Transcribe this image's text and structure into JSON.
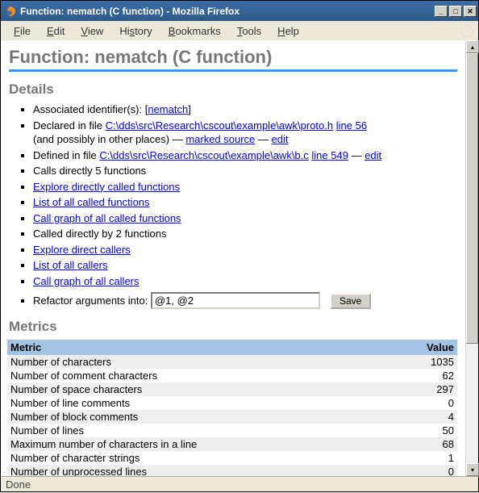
{
  "window": {
    "title": "Function: nematch (C function) - Mozilla Firefox"
  },
  "menu": {
    "file": "File",
    "edit": "Edit",
    "view": "View",
    "history": "History",
    "bookmarks": "Bookmarks",
    "tools": "Tools",
    "help": "Help"
  },
  "page": {
    "heading": "Function: nematch (C function)",
    "details_heading": "Details",
    "metrics_heading": "Metrics"
  },
  "details": {
    "assoc_label": "Associated identifier(s): [",
    "assoc_link": "nematch",
    "assoc_close": "]",
    "declared_label": "Declared in file ",
    "declared_file": "C:\\dds\\src\\Research\\cscout\\example\\awk\\proto.h",
    "declared_line_label": "line 56",
    "declared_extra": "(and possibly in other places) — ",
    "marked_source": "marked source",
    "dash": " — ",
    "edit": "edit",
    "defined_label": "Defined in file ",
    "defined_file": "C:\\dds\\src\\Research\\cscout\\example\\awk\\b.c",
    "defined_line_label": "line 549",
    "calls_directly": "Calls directly 5 functions",
    "explore_called": "Explore directly called functions",
    "list_called": "List of all called functions",
    "graph_called": "Call graph of all called functions",
    "called_by": "Called directly by 2 functions",
    "explore_callers": "Explore direct callers",
    "list_callers": "List of all callers",
    "graph_callers": "Call graph of all callers",
    "refactor_label": "Refactor arguments into: ",
    "refactor_value": "@1, @2",
    "save_label": "Save"
  },
  "metrics": {
    "header_metric": "Metric",
    "header_value": "Value",
    "rows": [
      {
        "name": "Number of characters",
        "value": "1035"
      },
      {
        "name": "Number of comment characters",
        "value": "62"
      },
      {
        "name": "Number of space characters",
        "value": "297"
      },
      {
        "name": "Number of line comments",
        "value": "0"
      },
      {
        "name": "Number of block comments",
        "value": "4"
      },
      {
        "name": "Number of lines",
        "value": "50"
      },
      {
        "name": "Maximum number of characters in a line",
        "value": "68"
      },
      {
        "name": "Number of character strings",
        "value": "1"
      },
      {
        "name": "Number of unprocessed lines",
        "value": "0"
      }
    ]
  },
  "status": {
    "text": "Done"
  }
}
